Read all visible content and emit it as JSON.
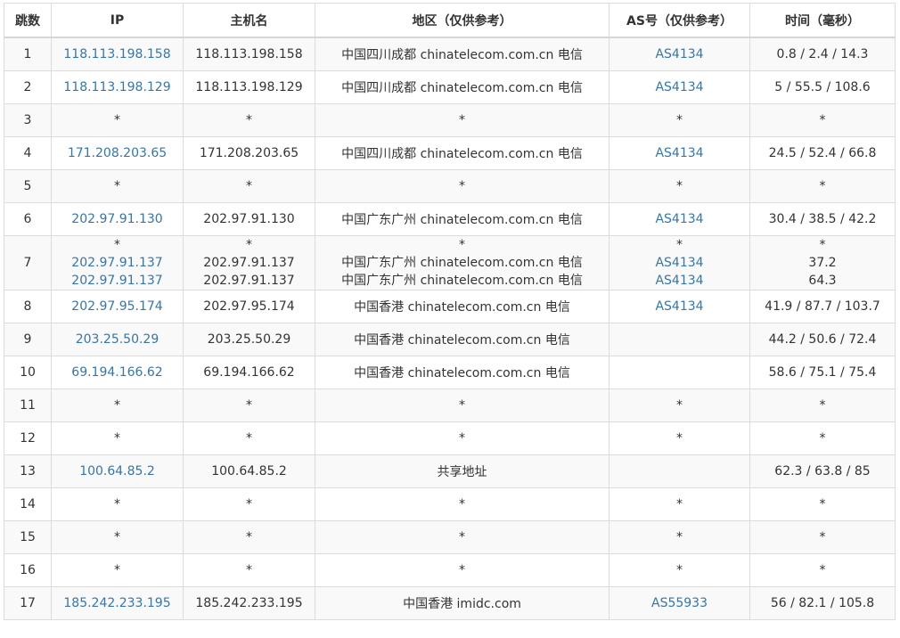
{
  "headers": {
    "hop": "跳数",
    "ip": "IP",
    "host": "主机名",
    "location": "地区（仅供参考）",
    "as": "AS号（仅供参考）",
    "time": "时间（毫秒）"
  },
  "link_color": "#3476ad",
  "rows": [
    {
      "hop": "1",
      "lines": [
        {
          "ip": "118.113.198.158",
          "host": "118.113.198.158",
          "location": "中国四川成都 chinatelecom.com.cn 电信",
          "as": "AS4134",
          "time": "0.8 / 2.4 / 14.3"
        }
      ]
    },
    {
      "hop": "2",
      "lines": [
        {
          "ip": "118.113.198.129",
          "host": "118.113.198.129",
          "location": "中国四川成都 chinatelecom.com.cn 电信",
          "as": "AS4134",
          "time": "5 / 55.5 / 108.6"
        }
      ]
    },
    {
      "hop": "3",
      "lines": [
        {
          "ip": "*",
          "host": "*",
          "location": "*",
          "as": "*",
          "time": "*"
        }
      ]
    },
    {
      "hop": "4",
      "lines": [
        {
          "ip": "171.208.203.65",
          "host": "171.208.203.65",
          "location": "中国四川成都 chinatelecom.com.cn 电信",
          "as": "AS4134",
          "time": "24.5 / 52.4 / 66.8"
        }
      ]
    },
    {
      "hop": "5",
      "lines": [
        {
          "ip": "*",
          "host": "*",
          "location": "*",
          "as": "*",
          "time": "*"
        }
      ]
    },
    {
      "hop": "6",
      "lines": [
        {
          "ip": "202.97.91.130",
          "host": "202.97.91.130",
          "location": "中国广东广州 chinatelecom.com.cn 电信",
          "as": "AS4134",
          "time": "30.4 / 38.5 / 42.2"
        }
      ]
    },
    {
      "hop": "7",
      "lines": [
        {
          "ip": "*",
          "host": "*",
          "location": "*",
          "as": "*",
          "time": "*"
        },
        {
          "ip": "202.97.91.137",
          "host": "202.97.91.137",
          "location": "中国广东广州 chinatelecom.com.cn 电信",
          "as": "AS4134",
          "time": "37.2"
        },
        {
          "ip": "202.97.91.137",
          "host": "202.97.91.137",
          "location": "中国广东广州 chinatelecom.com.cn 电信",
          "as": "AS4134",
          "time": "64.3"
        }
      ]
    },
    {
      "hop": "8",
      "lines": [
        {
          "ip": "202.97.95.174",
          "host": "202.97.95.174",
          "location": "中国香港 chinatelecom.com.cn 电信",
          "as": "AS4134",
          "time": "41.9 / 87.7 / 103.7"
        }
      ]
    },
    {
      "hop": "9",
      "lines": [
        {
          "ip": "203.25.50.29",
          "host": "203.25.50.29",
          "location": "中国香港 chinatelecom.com.cn 电信",
          "as": "",
          "time": "44.2 / 50.6 / 72.4"
        }
      ]
    },
    {
      "hop": "10",
      "lines": [
        {
          "ip": "69.194.166.62",
          "host": "69.194.166.62",
          "location": "中国香港 chinatelecom.com.cn 电信",
          "as": "",
          "time": "58.6 / 75.1 / 75.4"
        }
      ]
    },
    {
      "hop": "11",
      "lines": [
        {
          "ip": "*",
          "host": "*",
          "location": "*",
          "as": "*",
          "time": "*"
        }
      ]
    },
    {
      "hop": "12",
      "lines": [
        {
          "ip": "*",
          "host": "*",
          "location": "*",
          "as": "*",
          "time": "*"
        }
      ]
    },
    {
      "hop": "13",
      "lines": [
        {
          "ip": "100.64.85.2",
          "host": "100.64.85.2",
          "location": "共享地址",
          "as": "",
          "time": "62.3 / 63.8 / 85"
        }
      ]
    },
    {
      "hop": "14",
      "lines": [
        {
          "ip": "*",
          "host": "*",
          "location": "*",
          "as": "*",
          "time": "*"
        }
      ]
    },
    {
      "hop": "15",
      "lines": [
        {
          "ip": "*",
          "host": "*",
          "location": "*",
          "as": "*",
          "time": "*"
        }
      ]
    },
    {
      "hop": "16",
      "lines": [
        {
          "ip": "*",
          "host": "*",
          "location": "*",
          "as": "*",
          "time": "*"
        }
      ]
    },
    {
      "hop": "17",
      "lines": [
        {
          "ip": "185.242.233.195",
          "host": "185.242.233.195",
          "location": "中国香港 imidc.com",
          "as": "AS55933",
          "time": "56 / 82.1 / 105.8"
        }
      ]
    }
  ]
}
